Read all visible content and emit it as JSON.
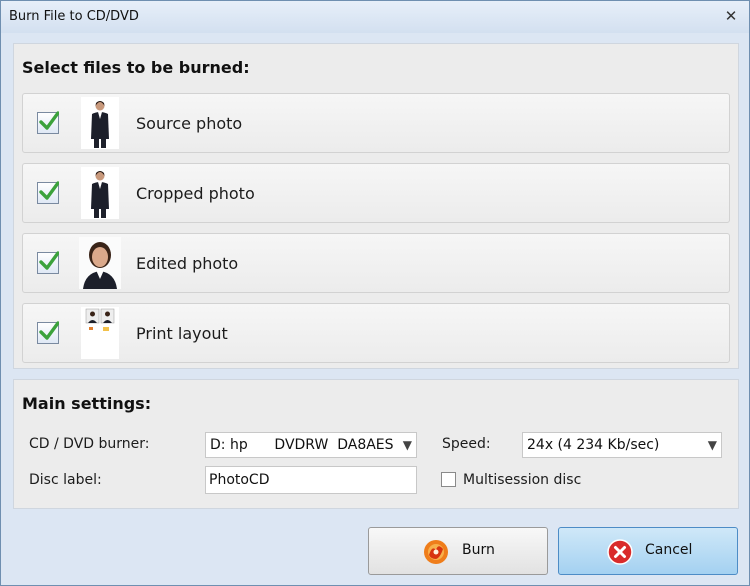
{
  "window": {
    "title": "Burn File to CD/DVD"
  },
  "files_section": {
    "title": "Select files to be burned:",
    "items": [
      {
        "label": "Source photo",
        "checked": true,
        "thumb": "standing-person-thumbnail"
      },
      {
        "label": "Cropped photo",
        "checked": true,
        "thumb": "standing-person-thumbnail"
      },
      {
        "label": "Edited photo",
        "checked": true,
        "thumb": "portrait-thumbnail"
      },
      {
        "label": "Print layout",
        "checked": true,
        "thumb": "print-layout-thumbnail"
      }
    ]
  },
  "settings": {
    "title": "Main settings:",
    "burner_label": "CD / DVD burner:",
    "burner_value": "D: hp      DVDRW  DA8AES",
    "speed_label": "Speed:",
    "speed_value": "24x (4 234 Kb/sec)",
    "disc_label_label": "Disc label:",
    "disc_label_value": "PhotoCD",
    "multisession_label": "Multisession disc",
    "multisession_checked": false
  },
  "buttons": {
    "burn_label": "Burn",
    "cancel_label": "Cancel"
  },
  "colors": {
    "check": "#3ca23c",
    "cancel_icon": "#d92b2b",
    "burn_icon": "#ef7d1a",
    "cancel_bg": "#a4d1f1"
  }
}
